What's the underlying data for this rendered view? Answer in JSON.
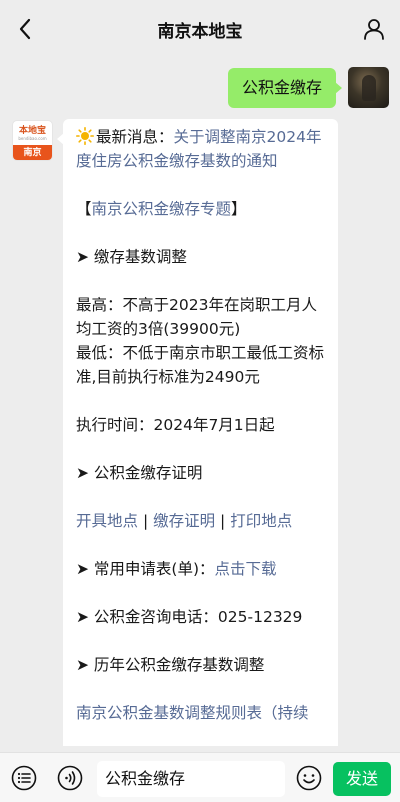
{
  "header": {
    "title": "南京本地宝"
  },
  "sent_message": {
    "text": "公积金缴存"
  },
  "bot": {
    "logo_text": "本地宝",
    "logo_small": "bendibao.com",
    "logo_city": "南京"
  },
  "reply": {
    "news_prefix": "最新消息：",
    "news_link": "关于调整南京2024年度住房公积金缴存基数的通知",
    "topic_open": "【",
    "topic_link": "南京公积金缴存专题",
    "topic_close": "】",
    "section1": "➤ 缴存基数调整",
    "max_line": "最高：不高于2023年在岗职工月人均工资的3倍(39900元)",
    "min_line": "最低：不低于南京市职工最低工资标准,目前执行标准为2490元",
    "time_line": "执行时间：2024年7月1日起",
    "section2": "➤ 公积金缴存证明",
    "link_a": "开具地点",
    "sep": " | ",
    "link_b": "缴存证明",
    "link_c": "打印地点",
    "forms_prefix": "➤ 常用申请表(单)：",
    "forms_link": "点击下载",
    "phone_line": "➤ 公积金咨询电话：025-12329",
    "section3": "➤ 历年公积金缴存基数调整",
    "rules_link": "南京公积金基数调整规则表（持续"
  },
  "input": {
    "value": "公积金缴存"
  },
  "send_label": "发送",
  "icons": {
    "back": "chevron-left-icon",
    "profile": "person-icon",
    "menu": "menu-list-icon",
    "voice": "voice-icon",
    "emoji": "emoji-icon",
    "sun": "sun-icon"
  },
  "colors": {
    "background": "#ededed",
    "bubble_out": "#95ec69",
    "link": "#576b95",
    "send": "#07c160",
    "logo_orange": "#e8541c"
  }
}
